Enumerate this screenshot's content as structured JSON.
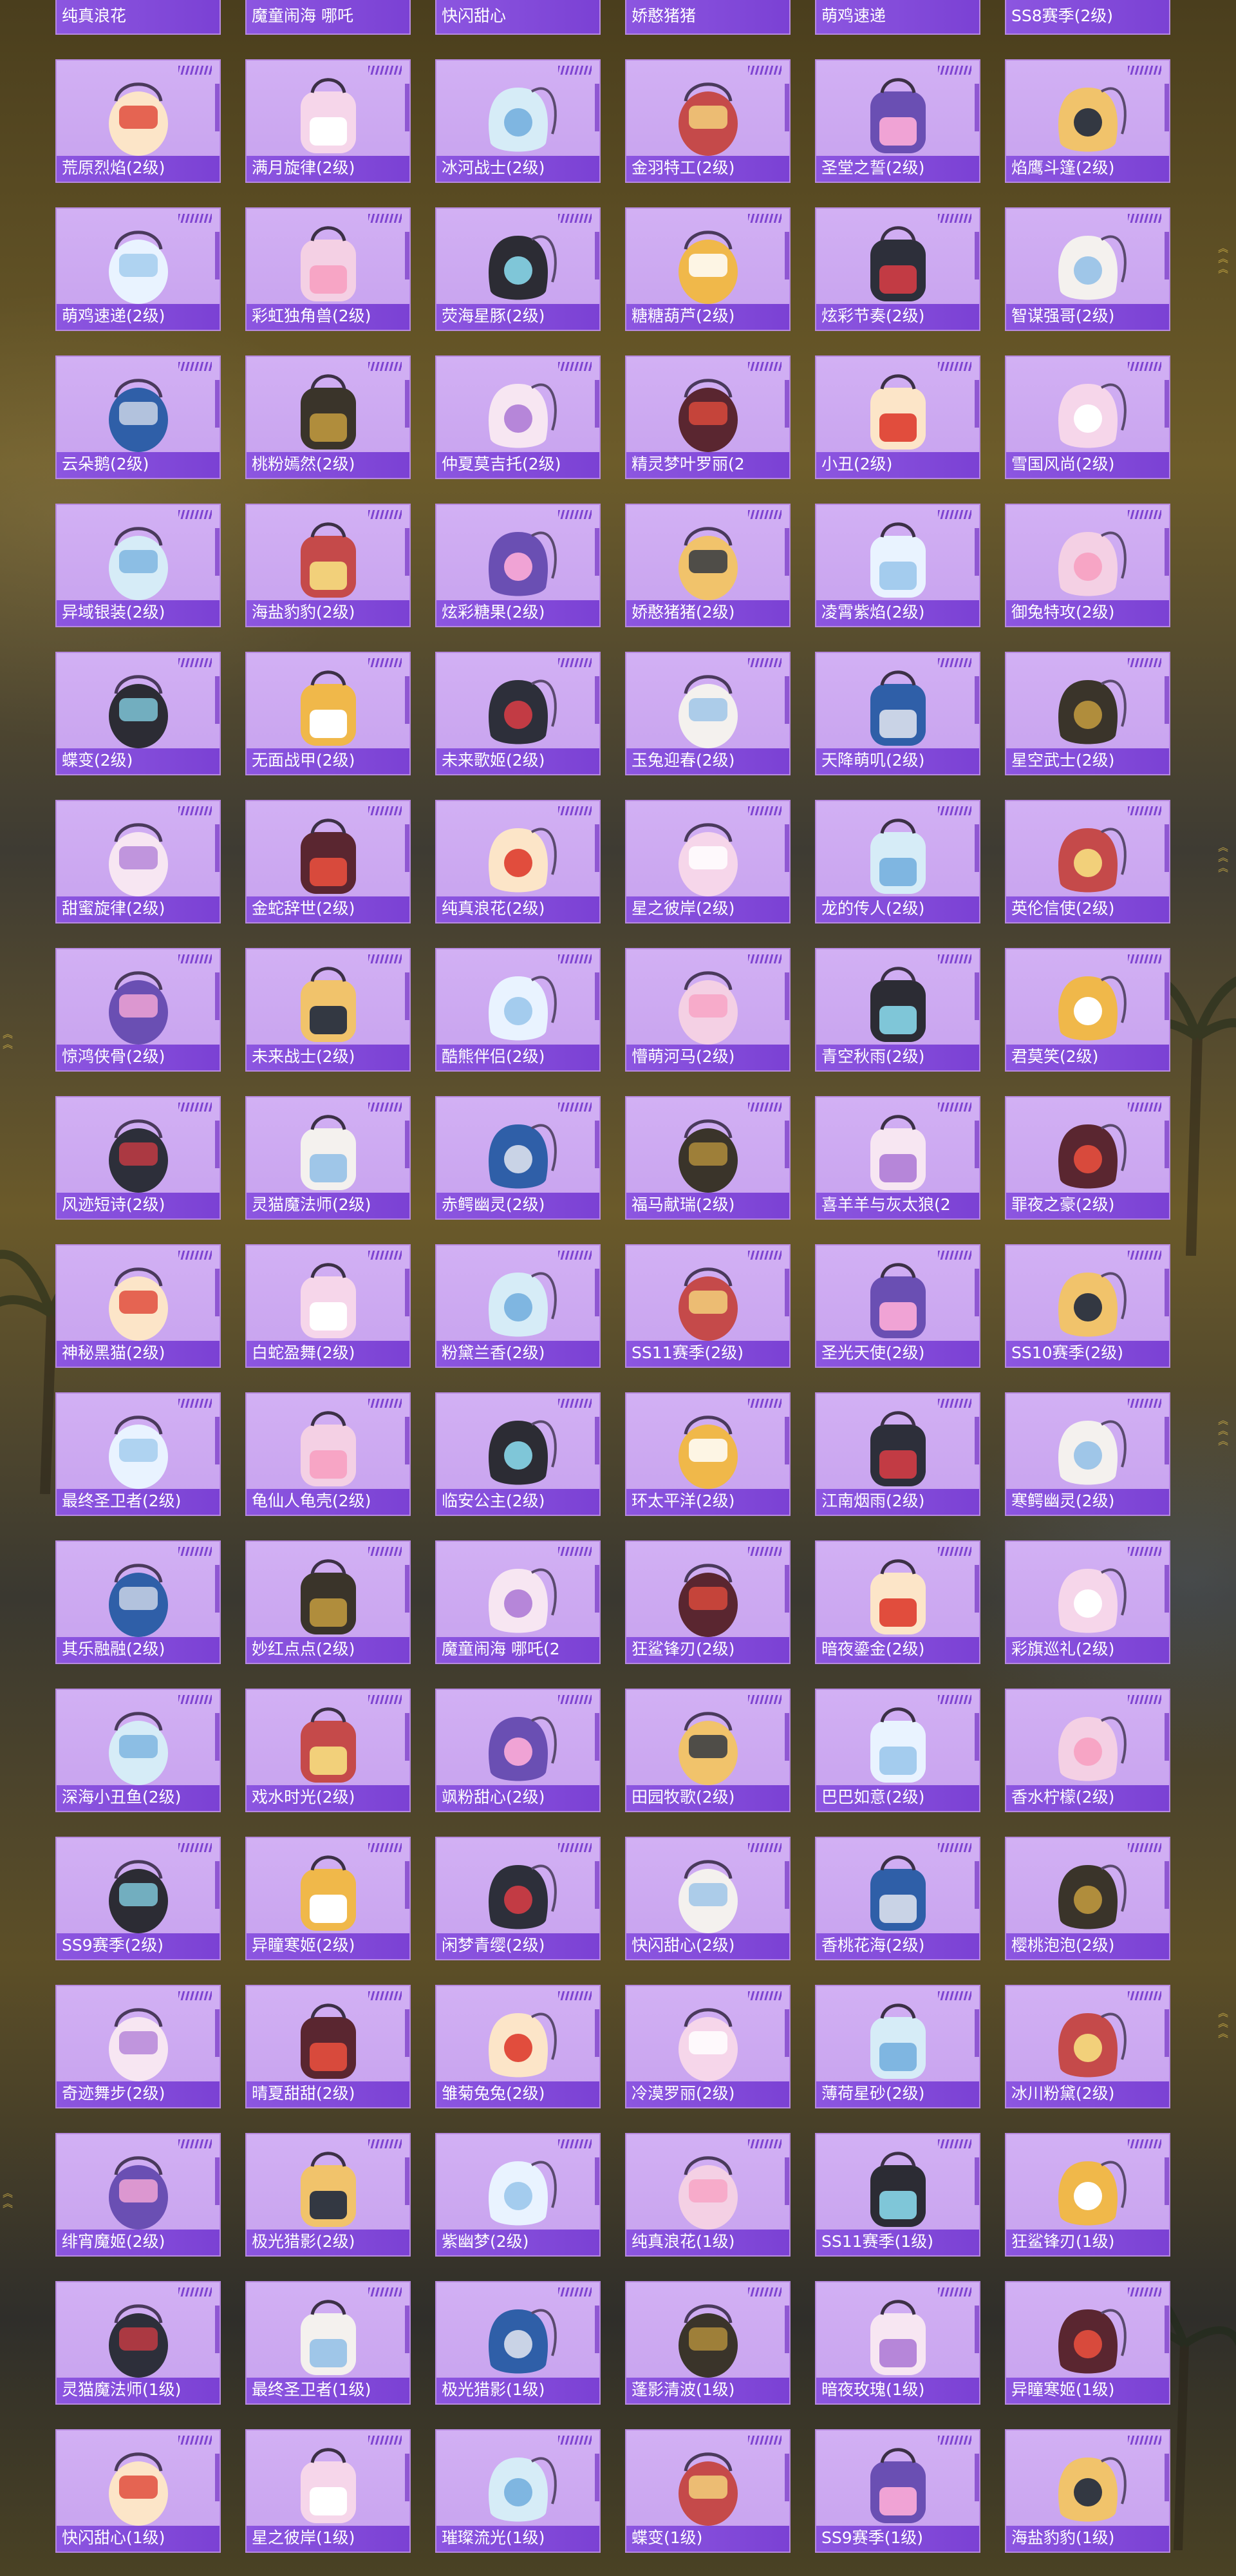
{
  "colors": {
    "card_bg": "#d2b0f4",
    "card_border": "#b789e0",
    "label_bar": "#8c56e0",
    "rarity_bars": "#7e44d1",
    "page_bg_dark": "#3e3b33",
    "page_bg_gold": "#6d5c2a",
    "chevron": "#d8b84a"
  },
  "icons": {
    "item_art": "backpack-icon",
    "rarity": "rarity-bars-icon",
    "side_nav": "double-chevron-icon"
  },
  "items": [
    [
      "纯真浪花",
      "魔童闹海 哪吒",
      "快闪甜心",
      "娇憨猪猪",
      "萌鸡速递",
      "SS8赛季(2级)"
    ],
    [
      "荒原烈焰(2级)",
      "满月旋律(2级)",
      "冰河战士(2级)",
      "金羽特工(2级)",
      "圣堂之誓(2级)",
      "焰鹰斗篷(2级)"
    ],
    [
      "萌鸡速递(2级)",
      "彩虹独角兽(2级)",
      "荧海星豚(2级)",
      "糖糖葫芦(2级)",
      "炫彩节奏(2级)",
      "智谋强哥(2级)"
    ],
    [
      "云朵鹅(2级)",
      "桃粉嫣然(2级)",
      "仲夏莫吉托(2级)",
      "精灵梦叶罗丽(2",
      "小丑(2级)",
      "雪国风尚(2级)"
    ],
    [
      "异域银装(2级)",
      "海盐豹豹(2级)",
      "炫彩糖果(2级)",
      "娇憨猪猪(2级)",
      "凌霄紫焰(2级)",
      "御兔特攻(2级)"
    ],
    [
      "蝶变(2级)",
      "无面战甲(2级)",
      "未来歌姬(2级)",
      "玉兔迎春(2级)",
      "天降萌叽(2级)",
      "星空武士(2级)"
    ],
    [
      "甜蜜旋律(2级)",
      "金蛇辞世(2级)",
      "纯真浪花(2级)",
      "星之彼岸(2级)",
      "龙的传人(2级)",
      "英伦信使(2级)"
    ],
    [
      "惊鸿侠骨(2级)",
      "未来战士(2级)",
      "酷熊伴侣(2级)",
      "懵萌河马(2级)",
      "青空秋雨(2级)",
      "君莫笑(2级)"
    ],
    [
      "风迹短诗(2级)",
      "灵猫魔法师(2级)",
      "赤鳄幽灵(2级)",
      "福马献瑞(2级)",
      "喜羊羊与灰太狼(2",
      "罪夜之豪(2级)"
    ],
    [
      "神秘黑猫(2级)",
      "白蛇盈舞(2级)",
      "粉黛兰香(2级)",
      "SS11赛季(2级)",
      "圣光天使(2级)",
      "SS10赛季(2级)"
    ],
    [
      "最终圣卫者(2级)",
      "龟仙人龟壳(2级)",
      "临安公主(2级)",
      "环太平洋(2级)",
      "江南烟雨(2级)",
      "寒鳄幽灵(2级)"
    ],
    [
      "其乐融融(2级)",
      "妙红点点(2级)",
      "魔童闹海 哪吒(2",
      "狂鲨锋刃(2级)",
      "暗夜鎏金(2级)",
      "彩旗巡礼(2级)"
    ],
    [
      "深海小丑鱼(2级)",
      "戏水时光(2级)",
      "飒粉甜心(2级)",
      "田园牧歌(2级)",
      "巴巴如意(2级)",
      "香水柠檬(2级)"
    ],
    [
      "SS9赛季(2级)",
      "异瞳寒姬(2级)",
      "闲梦青缨(2级)",
      "快闪甜心(2级)",
      "香桃花海(2级)",
      "樱桃泡泡(2级)"
    ],
    [
      "奇迹舞步(2级)",
      "晴夏甜甜(2级)",
      "雏菊兔兔(2级)",
      "冷漠罗丽(2级)",
      "薄荷星砂(2级)",
      "冰川粉黛(2级)"
    ],
    [
      "绯宵魔姬(2级)",
      "极光猎影(2级)",
      "紫幽梦(2级)",
      "纯真浪花(1级)",
      "SS11赛季(1级)",
      "狂鲨锋刃(1级)"
    ],
    [
      "灵猫魔法师(1级)",
      "最终圣卫者(1级)",
      "极光猎影(1级)",
      "蓬影清波(1级)",
      "暗夜玫瑰(1级)",
      "异瞳寒姬(1级)"
    ],
    [
      "快闪甜心(1级)",
      "星之彼岸(1级)",
      "璀璨流光(1级)",
      "蝶变(1级)",
      "SS9赛季(1级)",
      "海盐豹豹(1级)"
    ]
  ]
}
